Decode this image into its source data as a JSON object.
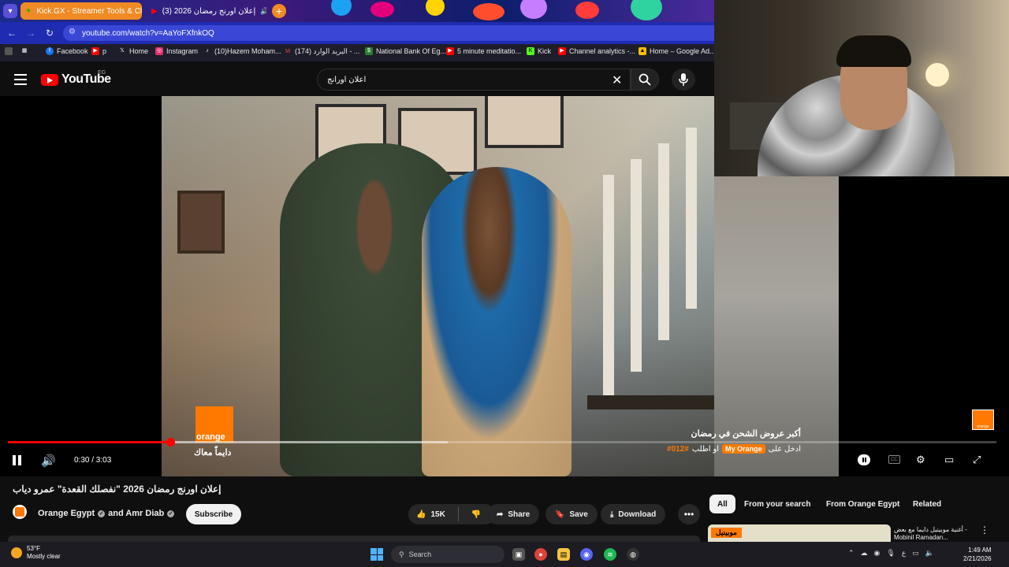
{
  "browser": {
    "tabs": [
      {
        "label": "Kick.GX - Streamer Tools & Cha",
        "active": true
      },
      {
        "label": "(3) إعلان اورنج رمضان 2026",
        "active": false
      }
    ],
    "new_tab_label": "+",
    "url": "youtube.com/watch?v=AaYoFXfnkOQ",
    "bookmarks": [
      {
        "label": "Facebook",
        "icon": "facebook-icon",
        "color": "#1877f2"
      },
      {
        "label": "p",
        "icon": "youtube-icon",
        "color": "#ff0000"
      },
      {
        "label": "Home",
        "icon": "x-icon",
        "color": "#000000"
      },
      {
        "label": "Instagram",
        "icon": "instagram-icon",
        "color": "#e1306c"
      },
      {
        "label": "(10)Hazem Moham...",
        "icon": "tiktok-icon",
        "color": "#000000"
      },
      {
        "label": "(174) البريد الوارد - ...",
        "icon": "gmail-icon",
        "color": "#ea4335"
      },
      {
        "label": "National Bank Of Eg...",
        "icon": "bank-icon",
        "color": "#2e7d32"
      },
      {
        "label": "5 minute meditatio...",
        "icon": "youtube-icon",
        "color": "#ff0000"
      },
      {
        "label": "Kick",
        "icon": "kick-icon",
        "color": "#53fc18"
      },
      {
        "label": "Channel analytics -...",
        "icon": "youtube-icon",
        "color": "#ff0000"
      },
      {
        "label": "Home – Google Ad...",
        "icon": "google-ads-icon",
        "color": "#fbbc04"
      }
    ]
  },
  "youtube": {
    "logo_text": "YouTube",
    "country": "EG",
    "search_query": "اعلان اورانج"
  },
  "player": {
    "current_time": "0:30",
    "duration": "3:03",
    "time_display": "0:30 / 3:03",
    "progress_fraction": 0.164,
    "buffered_fraction": 0.445,
    "overlay": {
      "brand": "orange",
      "slogan": "دايماً معاك",
      "caption_line1": "أكبر عروض الشحن في رمضان",
      "caption_line2_prefix": "ادخل على",
      "caption_app": "My Orange",
      "caption_or": "او اطلب",
      "caption_code": "#012#",
      "corner_logo": "orange"
    }
  },
  "video": {
    "title": "إعلان اورنج رمضان 2026 \"نفصلك القعدة\" عمرو دياب",
    "channel": "Orange Egypt",
    "channel_joiner": "and Amr Diab",
    "subscribe_label": "Subscribe",
    "likes": "15K",
    "share_label": "Share",
    "save_label": "Save",
    "download_label": "Download"
  },
  "sidebar": {
    "chips": [
      "All",
      "From your search",
      "From Orange Egypt",
      "Related"
    ],
    "recommendation": {
      "thumb_tag": "موبينيل",
      "title": "أغنية موبينيل دايما مع بعض - Mobinil Ramadan..."
    }
  },
  "taskbar": {
    "temperature": "53°F",
    "weather": "Mostly clear",
    "search_placeholder": "Search",
    "time": "1:49 AM",
    "date": "2/21/2026",
    "lang": "ع"
  },
  "colors": {
    "accent_red": "#ff0000",
    "brand_orange": "#ff7900",
    "tab_orange": "#f08a24",
    "address_blue": "#1f2bb0"
  }
}
